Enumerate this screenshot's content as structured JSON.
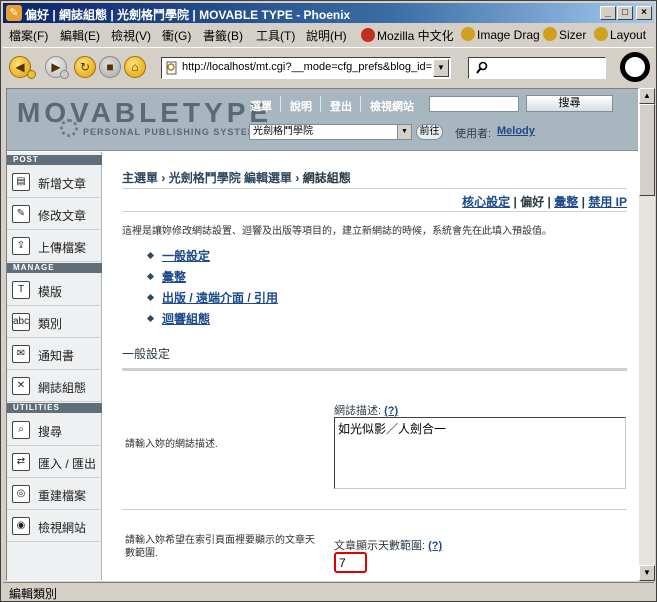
{
  "window": {
    "title": "偏好 | 網誌組態 | 光劍格鬥學院 | MOVABLE TYPE - Phoenix",
    "title_icon": "phoenix-icon",
    "minimize": "_",
    "maximize": "□",
    "close": "×"
  },
  "menubar": {
    "items": [
      "檔案(F)",
      "編輯(E)",
      "檢視(V)",
      "衝(G)",
      "書籤(B)",
      "工具(T)",
      "說明(H)"
    ],
    "extras": [
      "Mozilla 中文化",
      "Image Drag",
      "Sizer",
      "Layout"
    ]
  },
  "navbar": {
    "url": "http://localhost/mt.cgi?__mode=cfg_prefs&blog_id=1",
    "search_value": ""
  },
  "mt": {
    "logo_text": "MOVABLETYPE",
    "logo_sub": "PERSONAL PUBLISHING SYSTEM",
    "top_links": [
      "選單",
      "說明",
      "登出",
      "檢視網站"
    ],
    "search_button": "搜尋",
    "blog_select": "光劍格鬥學院",
    "go_button": "前往",
    "user_label": "使用者:",
    "user_name": "Melody"
  },
  "sidebar": {
    "sections": {
      "post": "POST",
      "manage": "MANAGE",
      "utilities": "UTILITIES"
    },
    "items": [
      {
        "label": "新增文章",
        "icon": "new-entry-icon"
      },
      {
        "label": "修改文章",
        "icon": "edit-entries-icon"
      },
      {
        "label": "上傳檔案",
        "icon": "upload-file-icon"
      },
      {
        "label": "模版",
        "icon": "templates-icon"
      },
      {
        "label": "類別",
        "icon": "categories-icon"
      },
      {
        "label": "通知書",
        "icon": "notifications-icon"
      },
      {
        "label": "網誌組態",
        "icon": "weblog-config-icon"
      },
      {
        "label": "搜尋",
        "icon": "search-icon"
      },
      {
        "label": "匯入 / 匯出",
        "icon": "import-export-icon"
      },
      {
        "label": "重建檔案",
        "icon": "rebuild-icon"
      },
      {
        "label": "檢視網站",
        "icon": "view-site-icon"
      }
    ]
  },
  "content": {
    "breadcrumb": {
      "main": "主選單",
      "sep1": "›",
      "blog": "光劍格鬥學院 編輯選單",
      "sep2": "›",
      "current": "網誌組態"
    },
    "subnav": {
      "core": "核心設定",
      "sep1": "|",
      "prefs": "偏好",
      "sep2": "|",
      "archiving": "彙整",
      "sep3": "|",
      "ip_ban": "禁用 IP"
    },
    "intro": "這裡是讓妳修改網誌設置、迴響及出版等項目的，建立新網誌的時候，系統會先在此填入預設值。",
    "bullets": [
      "一般設定",
      "彙整",
      "出版 / 遠端介面 / 引用",
      "迴響組態"
    ],
    "section_title": "一般設定",
    "desc_label": "網誌描述:",
    "help": "(?)",
    "desc_value": "如光似影／人劍合一",
    "desc_help": "請輸入妳的網誌描述.",
    "days_help": "請輸入妳希望在索引頁面裡要顯示的文章天數範圍.",
    "days_label": "文章顯示天數範圍:",
    "days_value": "7"
  },
  "statusbar": {
    "text": "編輯類別"
  }
}
